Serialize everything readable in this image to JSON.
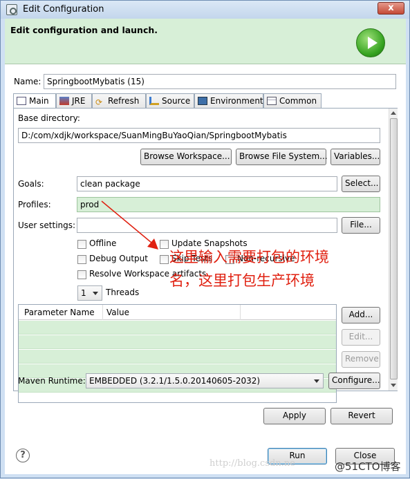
{
  "window": {
    "title": "Edit Configuration",
    "close_label": "x"
  },
  "header": {
    "title": "Edit configuration and launch."
  },
  "name_field": {
    "label": "Name:",
    "value": "SpringbootMybatis (15)"
  },
  "tabs": [
    {
      "label": "Main",
      "icon": "main-tab-icon",
      "active": true
    },
    {
      "label": "JRE",
      "icon": "jre-icon"
    },
    {
      "label": "Refresh",
      "icon": "refresh-icon"
    },
    {
      "label": "Source",
      "icon": "source-icon"
    },
    {
      "label": "Environment",
      "icon": "environment-icon"
    },
    {
      "label": "Common",
      "icon": "common-icon"
    }
  ],
  "main": {
    "base_dir_label": "Base directory:",
    "base_dir_value": "D:/com/xdjk/workspace/SuanMingBuYaoQian/SpringbootMybatis",
    "browse_workspace": "Browse Workspace...",
    "browse_fs": "Browse File System...",
    "variables": "Variables...",
    "goals_label": "Goals:",
    "goals_value": "clean package",
    "select_btn": "Select...",
    "profiles_label": "Profiles:",
    "profiles_value": "prod",
    "user_settings_label": "User settings:",
    "user_settings_value": "",
    "file_btn": "File...",
    "checkboxes": {
      "offline": "Offline",
      "update_snapshots": "Update Snapshots",
      "debug_output": "Debug Output",
      "skip_tests": "Skip Tests",
      "non_recursive": "Non-recursive",
      "resolve_workspace": "Resolve Workspace artifacts"
    },
    "threads_value": "1",
    "threads_label": "Threads",
    "param_table": {
      "headers": [
        "Parameter Name",
        "Value",
        ""
      ],
      "rows": 5
    },
    "add_btn": "Add...",
    "edit_btn": "Edit...",
    "remove_btn": "Remove",
    "maven_runtime_label": "Maven Runtime:",
    "maven_runtime_value": "EMBEDDED (3.2.1/1.5.0.20140605-2032)",
    "configure_btn": "Configure..."
  },
  "footer": {
    "apply": "Apply",
    "revert": "Revert",
    "run": "Run",
    "close": "Close",
    "help": "?"
  },
  "annotation": {
    "line1": "这里输入需要打包的环境",
    "line2": "名，这里打包生产环境",
    "color": "#e02010"
  },
  "watermark": {
    "url": "http://blog.csdn.ne",
    "brand": "@51CTO博客"
  }
}
